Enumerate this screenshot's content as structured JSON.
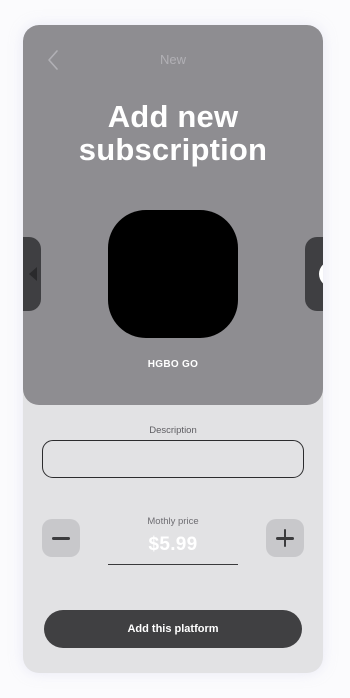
{
  "header": {
    "back_icon": "chevron-left-icon",
    "title": "New"
  },
  "hero": {
    "heading_line1": "Add new",
    "heading_line2": "subscription",
    "platform_name": "HGBO GO"
  },
  "form": {
    "description_label": "Description",
    "description_value": "",
    "price_label": "Mothly price",
    "price_value": "$5.99",
    "minus_icon": "minus-icon",
    "plus_icon": "plus-icon"
  },
  "actions": {
    "add_label": "Add this platform"
  },
  "colors": {
    "panel": "#8e8d91",
    "background": "#e2e2e4",
    "button": "#404042",
    "logo": "#000000"
  }
}
